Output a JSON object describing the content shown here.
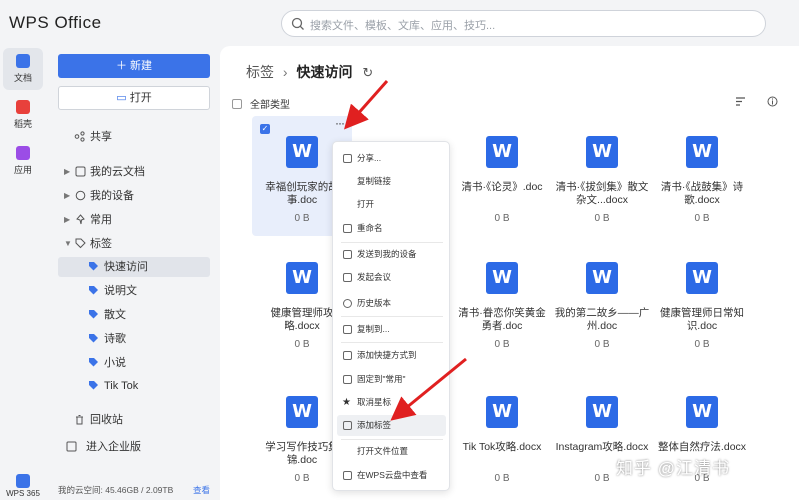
{
  "app": {
    "logo": "WPS Office"
  },
  "search": {
    "placeholder": "搜索文件、模板、文库、应用、技巧..."
  },
  "rail": {
    "items": [
      {
        "label": "文档",
        "color": "#3b73e8",
        "active": true
      },
      {
        "label": "稻壳",
        "color": "#e8403b",
        "active": false
      },
      {
        "label": "应用",
        "color": "#9b4de6",
        "active": false
      }
    ],
    "bottom_label": "WPS 365"
  },
  "sidebar": {
    "new_label": "新建",
    "open_label": "打开",
    "items": [
      {
        "label": "共享",
        "icon": "share-icon"
      },
      {
        "label": "我的云文档",
        "icon": "cloud-icon"
      },
      {
        "label": "我的设备",
        "icon": "device-icon"
      },
      {
        "label": "常用",
        "icon": "pin-icon"
      },
      {
        "label": "标签",
        "icon": "tag-icon"
      },
      {
        "label": "快速访问",
        "icon": "tag-icon"
      },
      {
        "label": "说明文",
        "icon": "tag-icon"
      },
      {
        "label": "散文",
        "icon": "tag-icon"
      },
      {
        "label": "诗歌",
        "icon": "tag-icon"
      },
      {
        "label": "小说",
        "icon": "tag-icon"
      },
      {
        "label": "Tik Tok",
        "icon": "tag-icon"
      },
      {
        "label": "回收站",
        "icon": "trash-icon"
      },
      {
        "label": "进入企业版",
        "icon": "enterprise-icon"
      }
    ],
    "storage_label": "我的云空间: 45.46GB / 2.09TB",
    "storage_link": "查看"
  },
  "main": {
    "breadcrumb_root": "标签",
    "breadcrumb_current": "快速访问",
    "filter_label": "全部类型",
    "files": [
      {
        "name": "幸福创玩家的故事.doc",
        "size": "0 B",
        "selected": true
      },
      {
        "name": "",
        "size": "",
        "selected": false
      },
      {
        "name": "清书·《论灵》.doc",
        "size": "0 B",
        "selected": false
      },
      {
        "name": "清书·《拔剑集》散文杂文...docx",
        "size": "0 B",
        "selected": false
      },
      {
        "name": "清书·《战鼓集》诗歌.docx",
        "size": "0 B",
        "selected": false
      },
      {
        "name": "健康管理师攻略.docx",
        "size": "0 B",
        "selected": false
      },
      {
        "name": "",
        "size": "",
        "selected": false
      },
      {
        "name": "清书·眷恋你笑黄金勇者.doc",
        "size": "0 B",
        "selected": false
      },
      {
        "name": "我的第二故乡——广州.doc",
        "size": "0 B",
        "selected": false
      },
      {
        "name": "健康管理师日常知识.doc",
        "size": "0 B",
        "selected": false
      },
      {
        "name": "学习写作技巧集锦.doc",
        "size": "0 B",
        "selected": false
      },
      {
        "name": "",
        "size": "",
        "selected": false
      },
      {
        "name": "Tik Tok攻略.docx",
        "size": "0 B",
        "selected": false
      },
      {
        "name": "Instagram攻略.docx",
        "size": "0 B",
        "selected": false
      },
      {
        "name": "整体自然疗法.docx",
        "size": "0 B",
        "selected": false
      }
    ]
  },
  "context_menu": {
    "items": [
      {
        "label": "分享..."
      },
      {
        "label": "复制链接"
      },
      {
        "label": "打开"
      },
      {
        "label": "重命名"
      },
      {
        "label": "发送到我的设备"
      },
      {
        "label": "发起会议"
      },
      {
        "label": "历史版本"
      },
      {
        "label": "复制到..."
      },
      {
        "label": "添加快捷方式到"
      },
      {
        "label": "固定到\"常用\""
      },
      {
        "label": "取消星标"
      },
      {
        "label": "添加标签"
      },
      {
        "label": "打开文件位置"
      },
      {
        "label": "在WPS云盘中查看"
      }
    ]
  },
  "watermark": "知乎 @江清书",
  "colors": {
    "accent": "#3b73e8",
    "word_blue": "#2c6ae6",
    "arrow_red": "#e02020"
  }
}
